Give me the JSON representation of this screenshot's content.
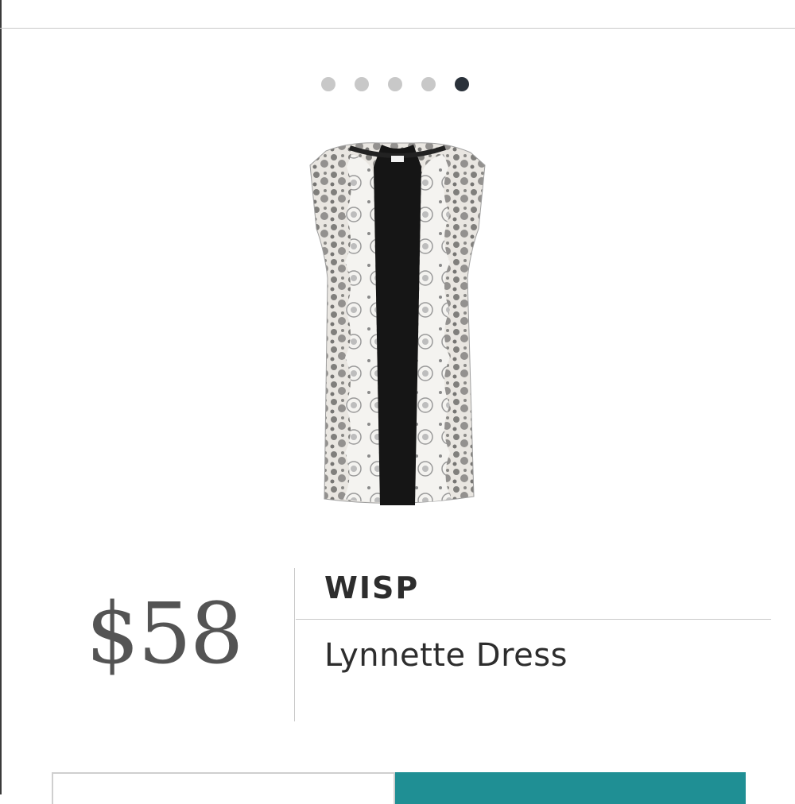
{
  "carousel": {
    "total": 5,
    "active_index": 4
  },
  "product": {
    "image_icon": "dress-image",
    "price": "$58",
    "brand": "WISP",
    "name": "Lynnette Dress"
  },
  "colors": {
    "accent": "#1f8f94",
    "active_dot": "#2a313a",
    "inactive_dot": "#c8c8c8",
    "price_text": "#545454",
    "text": "#2d2d2d"
  }
}
